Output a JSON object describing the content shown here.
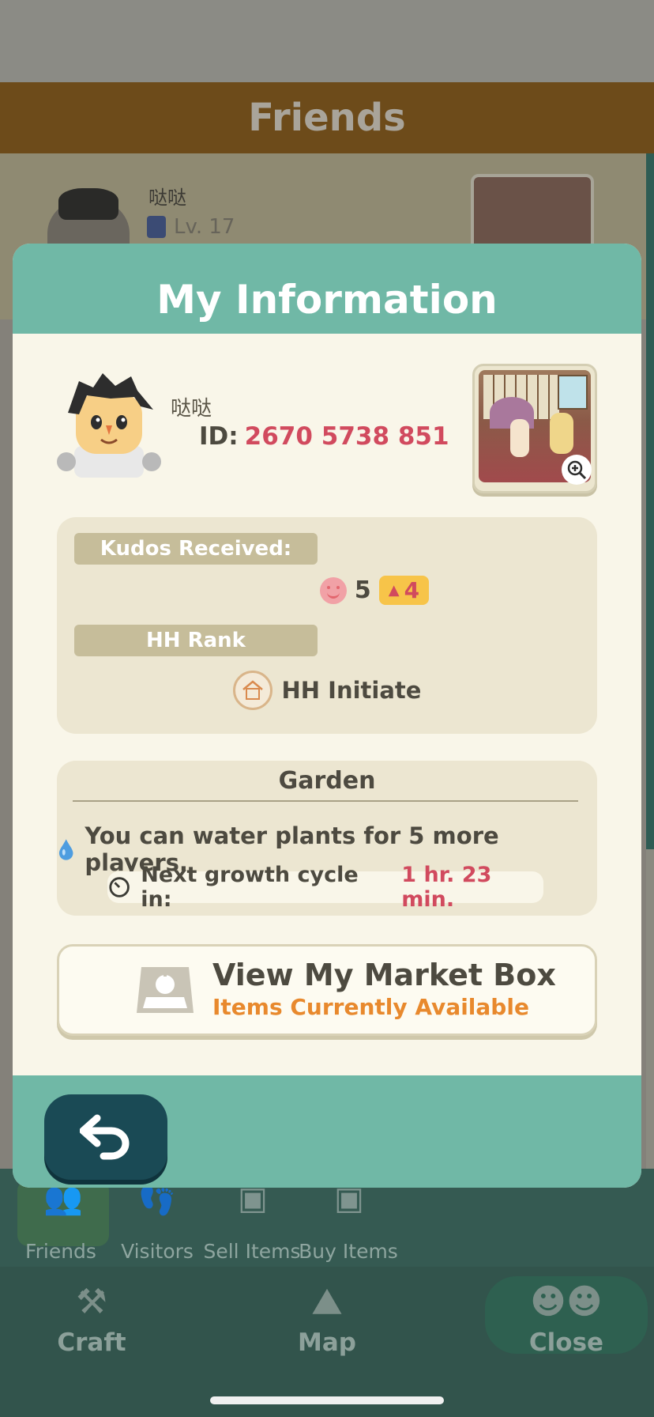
{
  "background": {
    "header_title": "Friends",
    "friend": {
      "name": "哒哒",
      "level": "Lv. 17"
    },
    "subnav": [
      {
        "label": "Friends",
        "icon": "friends-icon"
      },
      {
        "label": "Visitors",
        "icon": "footprints-icon"
      },
      {
        "label": "Sell Items",
        "icon": "market-box-icon"
      },
      {
        "label": "Buy Items",
        "icon": "buy-items-icon"
      }
    ],
    "mainnav": [
      {
        "label": "Craft",
        "icon": "hammer-icon"
      },
      {
        "label": "Map",
        "icon": "map-icon"
      },
      {
        "label": "Close",
        "icon": "close-villagers-icon"
      }
    ]
  },
  "modal": {
    "title": "My Information",
    "profile": {
      "name": "哒哒",
      "id_label": "ID:",
      "id_value": "2670 5738 851"
    },
    "kudos": {
      "label": "Kudos Received:",
      "count": "5",
      "badge": "4"
    },
    "rank": {
      "label": "HH Rank",
      "value": "HH Initiate"
    },
    "garden": {
      "title": "Garden",
      "water_text": "You can water plants for 5 more players.",
      "growth_label": "Next growth cycle in:",
      "growth_time": "1 hr. 23 min."
    },
    "market": {
      "title": "View My Market Box",
      "subtitle": "Items Currently Available"
    }
  },
  "colors": {
    "accent": "#70b8a6",
    "highlight": "#d14a5e",
    "orange": "#e8892d",
    "dark_teal": "#1a4a55"
  }
}
